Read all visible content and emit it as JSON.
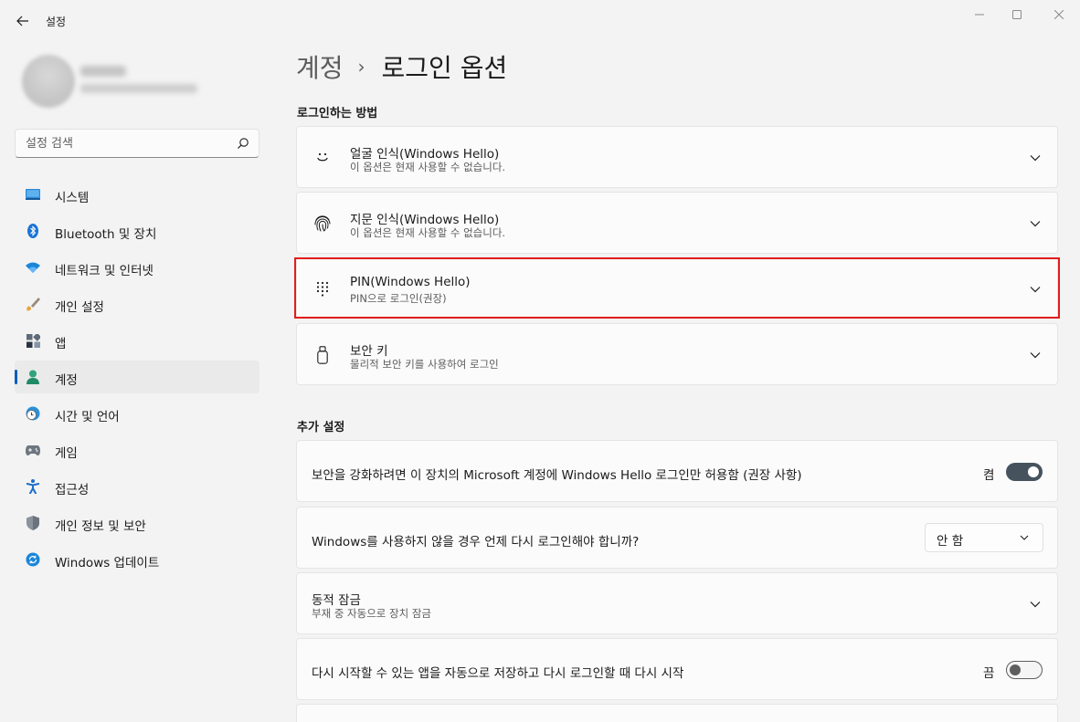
{
  "window": {
    "app_title": "설정"
  },
  "profile": {
    "name": "",
    "email": ""
  },
  "search": {
    "placeholder": "설정 검색"
  },
  "sidebar": {
    "items": [
      {
        "label": "시스템",
        "icon": "system-icon"
      },
      {
        "label": "Bluetooth 및 장치",
        "icon": "bluetooth-icon"
      },
      {
        "label": "네트워크 및 인터넷",
        "icon": "wifi-icon"
      },
      {
        "label": "개인 설정",
        "icon": "paintbrush-icon"
      },
      {
        "label": "앱",
        "icon": "apps-icon"
      },
      {
        "label": "계정",
        "icon": "account-icon",
        "active": true
      },
      {
        "label": "시간 및 언어",
        "icon": "time-language-icon"
      },
      {
        "label": "게임",
        "icon": "gamepad-icon"
      },
      {
        "label": "접근성",
        "icon": "accessibility-icon"
      },
      {
        "label": "개인 정보 및 보안",
        "icon": "shield-icon"
      },
      {
        "label": "Windows 업데이트",
        "icon": "update-icon"
      }
    ]
  },
  "breadcrumb": {
    "parent": "계정",
    "separator": "›",
    "current": "로그인 옵션"
  },
  "signin_methods": {
    "title": "로그인하는 방법",
    "items": [
      {
        "title": "얼굴 인식(Windows Hello)",
        "subtitle": "이 옵션은 현재 사용할 수 없습니다.",
        "icon": "face-icon"
      },
      {
        "title": "지문 인식(Windows Hello)",
        "subtitle": "이 옵션은 현재 사용할 수 없습니다.",
        "icon": "fingerprint-icon"
      },
      {
        "title": "PIN(Windows Hello)",
        "subtitle": "PIN으로 로그인(권장)",
        "icon": "pin-keypad-icon",
        "highlighted": true
      },
      {
        "title": "보안 키",
        "subtitle": "물리적 보안 키를 사용하여 로그인",
        "icon": "security-key-icon"
      }
    ]
  },
  "additional": {
    "title": "추가 설정",
    "hello_only": {
      "text": "보안을 강화하려면 이 장치의 Microsoft 계정에 Windows Hello 로그인만 허용함 (권장 사항)",
      "state_label": "켬",
      "on": true
    },
    "require_signin": {
      "text": "Windows를 사용하지 않을 경우 언제 다시 로그인해야 합니까?",
      "selected": "안 함"
    },
    "dynamic_lock": {
      "title": "동적 잠금",
      "subtitle": "부재 중 자동으로 장치 잠금"
    },
    "restart_apps": {
      "text": "다시 시작할 수 있는 앱을 자동으로 저장하고 다시 로그인할 때 다시 시작",
      "state_label": "끔",
      "on": false
    }
  },
  "colors": {
    "accent": "#005fb8",
    "highlight_border": "#e21c1c",
    "toggle_on": "#46535f"
  }
}
